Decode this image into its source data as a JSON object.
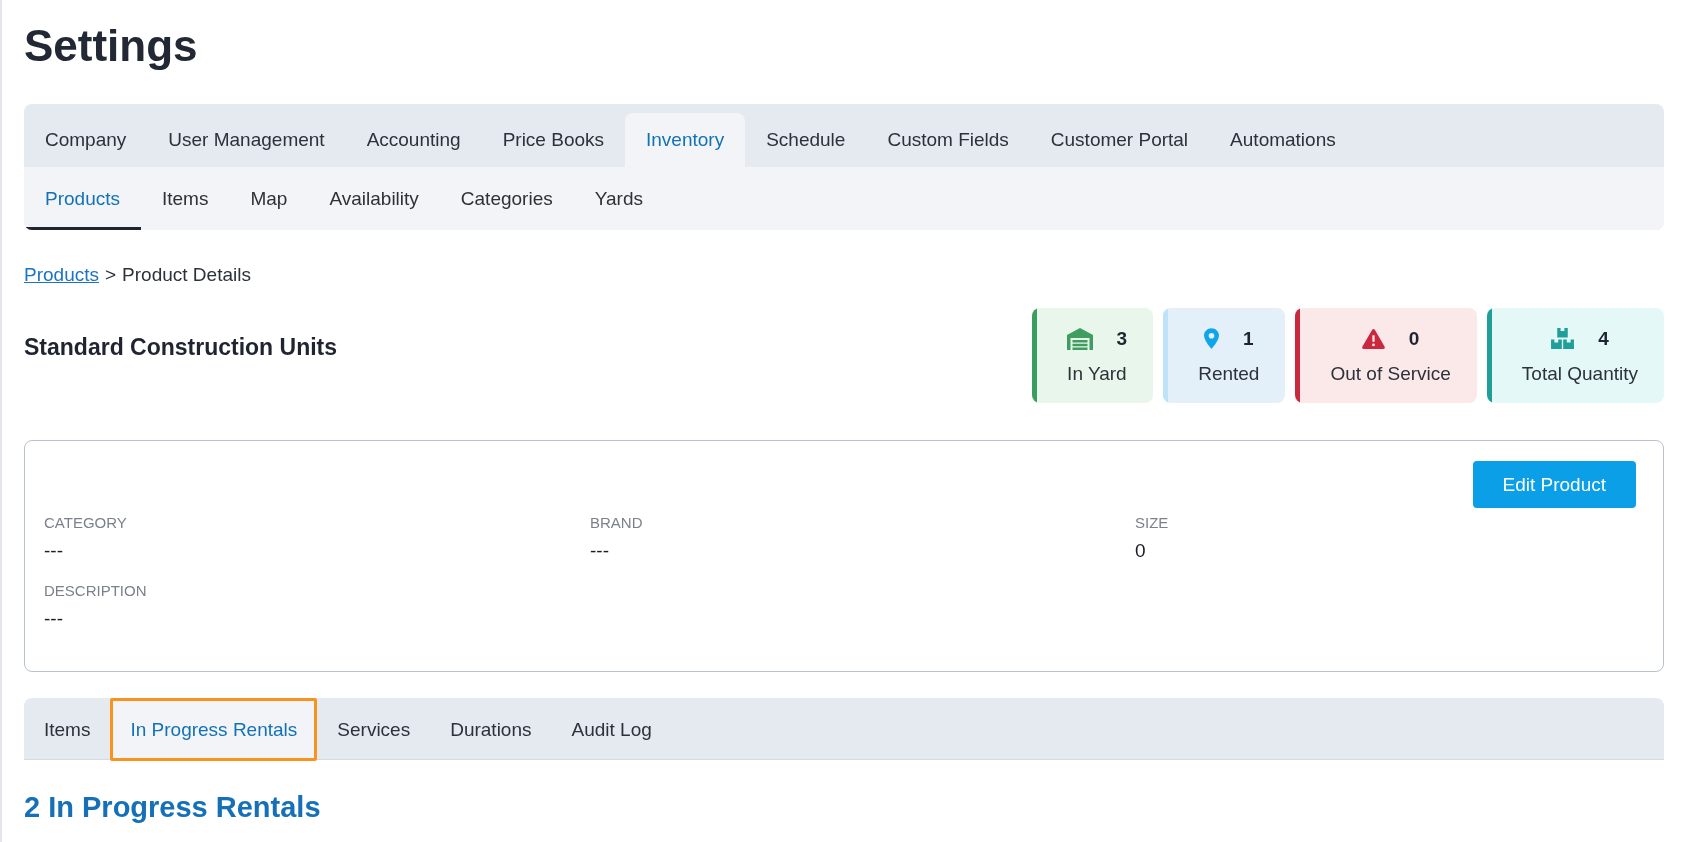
{
  "page": {
    "title": "Settings"
  },
  "main_tabs": [
    {
      "label": "Company",
      "selected": false
    },
    {
      "label": "User Management",
      "selected": false
    },
    {
      "label": "Accounting",
      "selected": false
    },
    {
      "label": "Price Books",
      "selected": false
    },
    {
      "label": "Inventory",
      "selected": true
    },
    {
      "label": "Schedule",
      "selected": false
    },
    {
      "label": "Custom Fields",
      "selected": false
    },
    {
      "label": "Customer Portal",
      "selected": false
    },
    {
      "label": "Automations",
      "selected": false
    }
  ],
  "sub_tabs": [
    {
      "label": "Products",
      "selected": true
    },
    {
      "label": "Items",
      "selected": false
    },
    {
      "label": "Map",
      "selected": false
    },
    {
      "label": "Availability",
      "selected": false
    },
    {
      "label": "Categories",
      "selected": false
    },
    {
      "label": "Yards",
      "selected": false
    }
  ],
  "breadcrumb": {
    "link": "Products",
    "separator": ">",
    "current": "Product Details"
  },
  "product": {
    "name": "Standard Construction Units"
  },
  "stats": [
    {
      "kind": "yard",
      "count": "3",
      "label": "In Yard",
      "color": "#3a9d5d"
    },
    {
      "kind": "rented",
      "count": "1",
      "label": "Rented",
      "color": "#bde3f9"
    },
    {
      "kind": "out_of_service",
      "count": "0",
      "label": "Out of Service",
      "color": "#c9283e"
    },
    {
      "kind": "total",
      "count": "4",
      "label": "Total Quantity",
      "color": "#1f9e9a"
    }
  ],
  "details": {
    "button": "Edit Product",
    "fields": [
      {
        "label": "CATEGORY",
        "value": "---"
      },
      {
        "label": "BRAND",
        "value": "---"
      },
      {
        "label": "SIZE",
        "value": "0"
      },
      {
        "label": "DESCRIPTION",
        "value": "---"
      }
    ]
  },
  "detail_tabs": [
    {
      "label": "Items",
      "selected": false,
      "highlighted": false
    },
    {
      "label": "In Progress Rentals",
      "selected": true,
      "highlighted": true
    },
    {
      "label": "Services",
      "selected": false,
      "highlighted": false
    },
    {
      "label": "Durations",
      "selected": false,
      "highlighted": false
    },
    {
      "label": "Audit Log",
      "selected": false,
      "highlighted": false
    }
  ],
  "section": {
    "heading": "2 In Progress Rentals"
  }
}
